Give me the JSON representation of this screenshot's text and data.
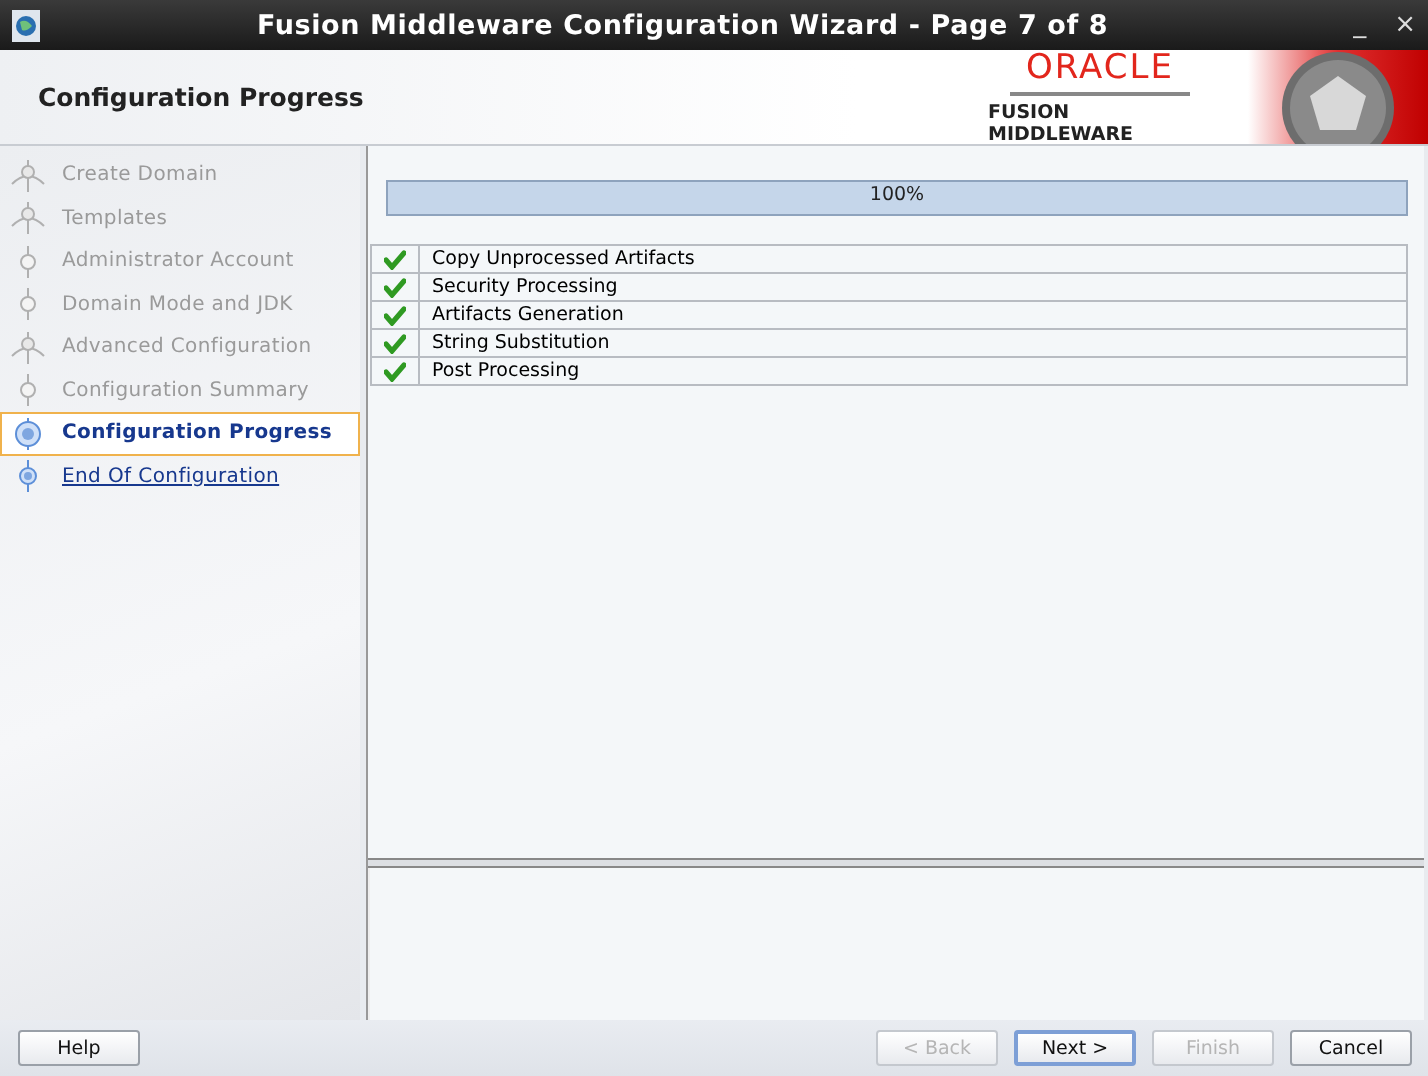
{
  "window": {
    "title": "Fusion Middleware Configuration Wizard - Page 7 of 8",
    "controls": [
      "_",
      "×"
    ]
  },
  "header": {
    "title": "Configuration Progress",
    "logo": {
      "brand": "ORACLE",
      "product": "FUSION MIDDLEWARE"
    }
  },
  "steps": [
    {
      "label": "Create Domain",
      "kind": "branch",
      "done": true,
      "selected": false
    },
    {
      "label": "Templates",
      "kind": "branch",
      "done": true,
      "selected": false
    },
    {
      "label": "Administrator Account",
      "kind": "step",
      "done": true,
      "selected": false
    },
    {
      "label": "Domain Mode and JDK",
      "kind": "step",
      "done": true,
      "selected": false
    },
    {
      "label": "Advanced Configuration",
      "kind": "branch",
      "done": true,
      "selected": false
    },
    {
      "label": "Configuration Summary",
      "kind": "step",
      "done": true,
      "selected": false
    },
    {
      "label": "Configuration Progress",
      "kind": "step",
      "done": false,
      "selected": true
    },
    {
      "label": "End Of Configuration",
      "kind": "step",
      "done": false,
      "selected": false
    }
  ],
  "progress": {
    "level": 1,
    "reading": "100%"
  },
  "tasks": [
    {
      "label": "Copy Unprocessed Artifacts",
      "checked": true
    },
    {
      "label": "Security Processing",
      "checked": true
    },
    {
      "label": "Artifacts Generation",
      "checked": true
    },
    {
      "label": "String Substitution",
      "checked": true
    },
    {
      "label": "Post Processing",
      "checked": true
    }
  ],
  "buttons": [
    {
      "label": "Help",
      "disabled": false,
      "focused": false
    },
    {
      "label": "< Back",
      "disabled": true,
      "focused": false
    },
    {
      "label": "Next >",
      "disabled": false,
      "focused": true
    },
    {
      "label": "Finish",
      "disabled": true,
      "focused": false
    },
    {
      "label": "Cancel",
      "disabled": false,
      "focused": false
    }
  ]
}
